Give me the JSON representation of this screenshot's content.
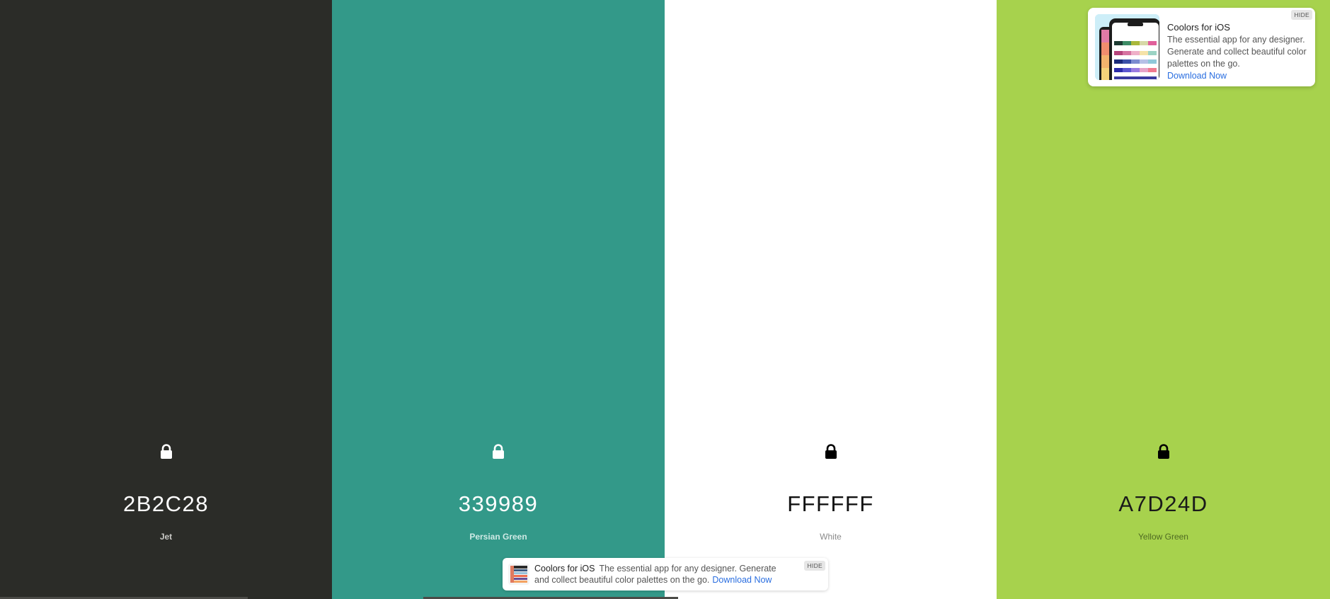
{
  "palette": {
    "colors": [
      {
        "hex": "2B2C28",
        "name": "Jet",
        "bg": "#2B2C28",
        "fg": "#ffffff",
        "name_color": "#c9c9c6",
        "lock_color": "#ffffff"
      },
      {
        "hex": "339989",
        "name": "Persian Green",
        "bg": "#339989",
        "fg": "#ffffff",
        "name_color": "#cfeae5",
        "lock_color": "#ffffff"
      },
      {
        "hex": "FFFFFF",
        "name": "White",
        "bg": "#FFFFFF",
        "fg": "#111111",
        "name_color": "#8a8a8a",
        "lock_color": "#000000"
      },
      {
        "hex": "A7D24D",
        "name": "Yellow Green",
        "bg": "#A7D24D",
        "fg": "#1a1a1a",
        "name_color": "#4f6a22",
        "lock_color": "#000000"
      }
    ]
  },
  "ad_card": {
    "title": "Coolors for iOS",
    "body": "The essential app for any designer. Generate and collect beautiful color palettes on the go.",
    "cta": "Download Now",
    "hide": "HIDE",
    "icon": "phone-app-preview"
  },
  "ad_bar": {
    "title": "Coolors for iOS",
    "body": "The essential app for any designer. Generate and collect beautiful color palettes on the go.",
    "cta": "Download Now",
    "hide": "HIDE",
    "icon": "palette-app-icon"
  }
}
